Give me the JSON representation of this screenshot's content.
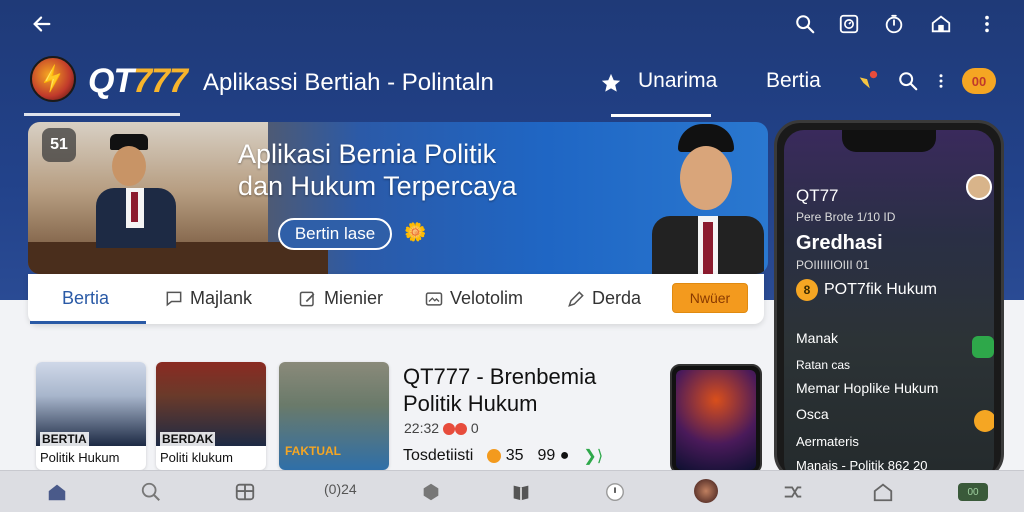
{
  "topbar": {
    "back_icon": "arrow-left-icon",
    "icons": [
      "search-icon",
      "timer-box-icon",
      "clock-icon",
      "home-icon",
      "more-vertical-icon"
    ]
  },
  "brand": {
    "name_prefix": "QT",
    "name_suffix": "777",
    "app_title": "Aplikassi Bertiah - Polintaln"
  },
  "nav": {
    "items": [
      {
        "label": "Unarima",
        "icon": "star-icon",
        "active": true
      },
      {
        "label": "Bertia",
        "active": false
      }
    ],
    "chip_label": "00"
  },
  "banner": {
    "badge": "51",
    "title_line1": "Aplikasi Bernia Politik",
    "title_line2": "dan Hukum Terpercaya",
    "button_label": "Bertin lase"
  },
  "tabs": [
    {
      "label": "Bertia",
      "icon": "",
      "active": true
    },
    {
      "label": "Majlank",
      "icon": "chat-icon",
      "active": false
    },
    {
      "label": "Mienier",
      "icon": "edit-icon",
      "active": false
    },
    {
      "label": "Velotolim",
      "icon": "image-icon",
      "active": false
    },
    {
      "label": "Derda",
      "icon": "pencil-icon",
      "active": false
    }
  ],
  "tab_cta": "Nwüer",
  "cards": [
    {
      "cap1": "BERTIA",
      "cap2": "Politik Hukum"
    },
    {
      "cap1": "BERDAK",
      "cap2": "Politi klukum"
    },
    {
      "cap1": "FAKTUAL",
      "cap2": ""
    }
  ],
  "article": {
    "title_line1": "QT777 - Brenbemia",
    "title_line2": "Politik Hukum",
    "meta_time": "22:32",
    "meta_count": "0",
    "source": "Tosdetiisti",
    "stat1": "35",
    "stat2": "99"
  },
  "phone": {
    "brand": "QT77",
    "sub": "Pere Brote 1/10 ID",
    "heading": "Gredhasi",
    "line": "POIIIIIIOIII 01",
    "pill": "POT7fik Hukum",
    "list": [
      "Manak",
      "Ratan cas",
      "Memar Hoplike Hukum",
      "Osca",
      "Aermateris",
      "Manais - Politik 862 20"
    ]
  },
  "bottom_nav": {
    "icons": [
      "home-icon",
      "search-icon",
      "grid-icon",
      "badge-icon",
      "cube-icon",
      "book-icon",
      "compass-icon",
      "avatar-icon",
      "shuffle-icon",
      "home-outline-icon",
      "battery-icon"
    ],
    "badge_text": "(0)24"
  },
  "colors": {
    "header": "#22428a",
    "accent": "#f39a1e",
    "active_tab": "#2a5aa6"
  }
}
